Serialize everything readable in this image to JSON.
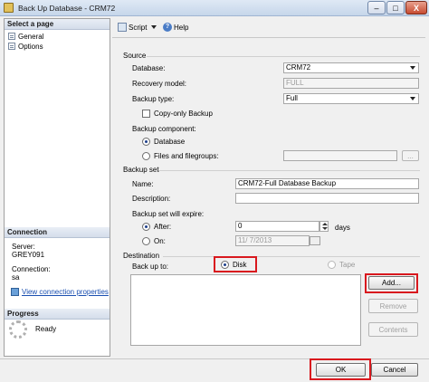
{
  "window": {
    "title": "Back Up Database - CRM72",
    "minimize": "–",
    "maximize": "□",
    "close": "X"
  },
  "left": {
    "select_page_header": "Select a page",
    "pages": [
      {
        "label": "General"
      },
      {
        "label": "Options"
      }
    ],
    "connection_header": "Connection",
    "server_label": "Server:",
    "server_value": "GREY091",
    "connection_label": "Connection:",
    "connection_value": "sa",
    "view_props": "View connection properties",
    "progress_header": "Progress",
    "progress_status": "Ready"
  },
  "toolbar": {
    "script": "Script",
    "help": "Help"
  },
  "source": {
    "header": "Source",
    "database_label": "Database:",
    "database_value": "CRM72",
    "recovery_label": "Recovery model:",
    "recovery_value": "FULL",
    "backup_type_label": "Backup type:",
    "backup_type_value": "Full",
    "copy_only": "Copy-only Backup",
    "component_label": "Backup component:",
    "component_database": "Database",
    "component_files": "Files and filegroups:"
  },
  "backup_set": {
    "header": "Backup set",
    "name_label": "Name:",
    "name_value": "CRM72-Full Database Backup",
    "description_label": "Description:",
    "description_value": "",
    "expire_label": "Backup set will expire:",
    "after_label": "After:",
    "after_value": "0",
    "days": "days",
    "on_label": "On:",
    "on_value": "11/ 7/2013"
  },
  "destination": {
    "header": "Destination",
    "backup_to_label": "Back up to:",
    "disk": "Disk",
    "tape": "Tape",
    "add": "Add...",
    "remove": "Remove",
    "contents": "Contents"
  },
  "buttons": {
    "ok": "OK",
    "cancel": "Cancel"
  },
  "colors": {
    "highlight": "#d9181e",
    "link": "#1a4fb0",
    "radio_dot": "#1d3f8a"
  },
  "icons": {
    "script": "script-icon",
    "help": "help-icon",
    "page": "page-icon",
    "properties": "properties-icon",
    "progress": "spinner-icon"
  }
}
